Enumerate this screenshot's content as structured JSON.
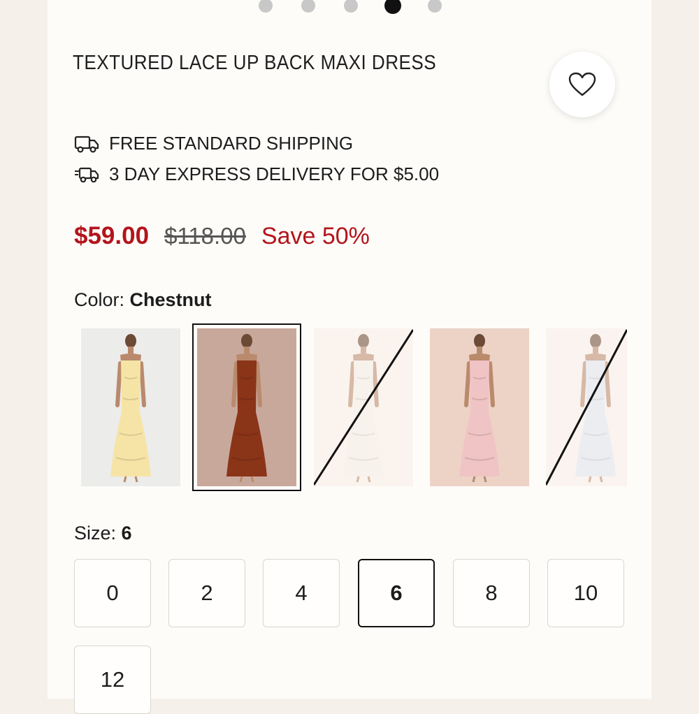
{
  "carousel": {
    "count": 5,
    "active_index": 3
  },
  "product": {
    "title": "TEXTURED LACE UP BACK MAXI DRESS"
  },
  "shipping": {
    "free_label": "FREE STANDARD SHIPPING",
    "express_label": "3 DAY EXPRESS DELIVERY FOR $5.00"
  },
  "price": {
    "current": "$59.00",
    "original": "$118.00",
    "save": "Save 50%"
  },
  "color": {
    "label": "Color:",
    "selected": "Chestnut",
    "swatches": [
      {
        "name": "swatch-yellow",
        "dress": "#f6e4a6",
        "bg": "#ececea",
        "available": true
      },
      {
        "name": "swatch-chestnut",
        "dress": "#8a3418",
        "bg": "#c9a89c",
        "available": true,
        "selected": true
      },
      {
        "name": "swatch-white",
        "dress": "#f5f2ea",
        "bg": "#fbf3ee",
        "available": false
      },
      {
        "name": "swatch-pink",
        "dress": "#f0c4c4",
        "bg": "#ecd3c6",
        "available": true
      },
      {
        "name": "swatch-light-blue",
        "dress": "#dfe9f4",
        "bg": "#fbf3ef",
        "available": false
      }
    ]
  },
  "size": {
    "label": "Size:",
    "selected": "6",
    "options": [
      "0",
      "2",
      "4",
      "6",
      "8",
      "10",
      "12"
    ]
  },
  "icons": {
    "wishlist": "heart-icon",
    "shipping": "truck-icon",
    "express": "fast-truck-icon"
  },
  "colors": {
    "sale_red": "#b3141b",
    "selected_border": "#111111"
  }
}
